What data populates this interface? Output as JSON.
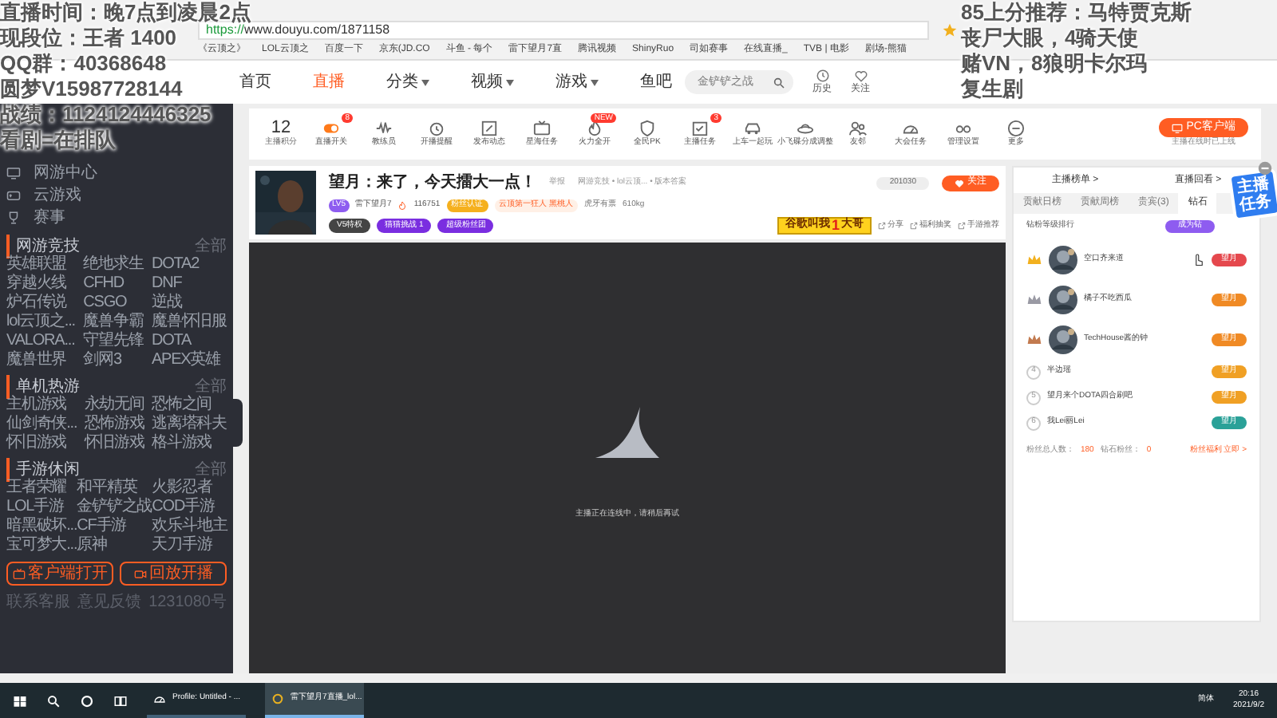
{
  "overlay": {
    "left_lines": [
      "直播时间：晚7点到凌晨2点",
      "现段位：王者 1400",
      "QQ群：40368648",
      "圆梦V15987728144",
      "战绩：1124124446325",
      "看剧=在排队"
    ],
    "right_lines": [
      "85上分推荐：马特贾克斯",
      "丧尸大眼，4骑天使",
      "赌VN，8狼明卡尔玛",
      "复生剧"
    ]
  },
  "browser": {
    "url_prefix": "https://",
    "url": "www.douyu.com/1871158",
    "bookmarks": [
      "《云顶之》",
      "LOL云顶之",
      "百度一下",
      "京东(JD.CO",
      "斗鱼 - 每个",
      "雷下望月7直",
      "腾讯视频",
      "ShinyRuo",
      "司如赛事",
      "在线直播_",
      "TVB | 电影",
      "剧场-熊猫"
    ]
  },
  "header": {
    "nav": [
      {
        "label": "首页",
        "selected": false,
        "caret": false
      },
      {
        "label": "直播",
        "selected": true,
        "caret": false
      },
      {
        "label": "分类",
        "selected": false,
        "caret": true
      },
      {
        "label": "视频",
        "selected": false,
        "caret": true
      },
      {
        "label": "游戏",
        "selected": false,
        "caret": true
      },
      {
        "label": "鱼吧",
        "selected": false,
        "caret": false
      }
    ],
    "search": {
      "placeholder": "金铲铲之战"
    },
    "actions": [
      "历史",
      "关注"
    ]
  },
  "toolbar": {
    "score": {
      "value": "12",
      "label": "主播积分"
    },
    "items": [
      {
        "label": "直播开关",
        "badge": "8"
      },
      {
        "label": "教练员"
      },
      {
        "label": "开播提醒"
      },
      {
        "label": "发布动态"
      },
      {
        "label": "星海任务"
      },
      {
        "label": "火力全开",
        "badge": "NEW"
      },
      {
        "label": "全民PK"
      },
      {
        "label": "主播任务",
        "badge": "3"
      },
      {
        "label": "上车一起玩"
      },
      {
        "label": "小飞碟分成调整"
      },
      {
        "label": "友邻"
      },
      {
        "label": "大会任务"
      },
      {
        "label": "管理设置"
      },
      {
        "label": "更多"
      }
    ],
    "pc_button": "PC客户端",
    "pc_note": "主播在线时已上线"
  },
  "sidebar": {
    "top": [
      "网游中心",
      "云游戏",
      "赛事"
    ],
    "sections": [
      {
        "title": "网游竞技",
        "more": "全部",
        "games": [
          "英雄联盟",
          "绝地求生",
          "DOTA2",
          "穿越火线",
          "CFHD",
          "DNF",
          "炉石传说",
          "CSGO",
          "逆战",
          "lol云顶之...",
          "魔兽争霸",
          "魔兽怀旧服",
          "VALORA...",
          "守望先锋",
          "DOTA",
          "魔兽世界",
          "剑网3",
          "APEX英雄"
        ]
      },
      {
        "title": "单机热游",
        "more": "全部",
        "games": [
          "主机游戏",
          "永劫无间",
          "恐怖之间",
          "仙剑奇侠...",
          "恐怖游戏",
          "逃离塔科夫",
          "怀旧游戏",
          "怀旧游戏",
          "格斗游戏"
        ]
      },
      {
        "title": "手游休闲",
        "more": "全部",
        "games": [
          "王者荣耀",
          "和平精英",
          "火影忍者",
          "LOL手游",
          "金铲铲之战",
          "COD手游",
          "暗黑破坏...",
          "CF手游",
          "欢乐斗地主",
          "宝可梦大...",
          "原神",
          "天刀手游"
        ]
      }
    ],
    "buttons": [
      "客户端打开",
      "回放开播"
    ],
    "footer": [
      "联系客服",
      "意见反馈",
      "1231080号"
    ]
  },
  "stream": {
    "title": "望月：来了，今天擂大一点！",
    "report": "举报",
    "breadcrumb": "网游竞技 • lol云顶... • 版本答案",
    "level": "LV5",
    "anchor": "雷下望月7",
    "heat": "116751",
    "fan_tag": "粉丝认证",
    "honor": "云顶第一狂人 黑桃人",
    "rank": "虎牙有票",
    "weight": "610kg",
    "room_id": "201030",
    "follow": "关注",
    "chips": [
      "V5特权",
      "猫猫挑战 1",
      "超级粉丝团"
    ],
    "promo": [
      "谷歌叫我",
      "1",
      "大哥"
    ],
    "actions": [
      "分享",
      "福利抽奖",
      "手游推荐"
    ]
  },
  "video": {
    "message": "主播正在连线中，请稍后再试"
  },
  "ranking": {
    "heads": [
      "主播榜单 >",
      "直播回看 >"
    ],
    "tabs": [
      {
        "label": "贡献日榜",
        "selected": false
      },
      {
        "label": "贡献周榜",
        "selected": false
      },
      {
        "label": "贵宾(3)",
        "selected": false
      },
      {
        "label": "钻石",
        "selected": true
      }
    ],
    "caption": "钻粉等级排行",
    "join": "成为钻",
    "sticker": "主播任务",
    "rows": [
      {
        "kind": "crown",
        "color": "#f2b01e",
        "name": "空口齐来道",
        "badge": {
          "label": "望月",
          "color": "#e5484d"
        }
      },
      {
        "kind": "crown",
        "color": "#9a9aa4",
        "name": "橘子不吃西瓜",
        "badge": {
          "label": "望月",
          "color": "#f08a24"
        }
      },
      {
        "kind": "crown",
        "color": "#c27a4f",
        "name": "TechHouse酱的钟",
        "badge": {
          "label": "望月",
          "color": "#f08a24"
        }
      },
      {
        "kind": "number",
        "rank": "4",
        "name": "半边瑶",
        "badge": {
          "label": "望月",
          "color": "#f0a024"
        }
      },
      {
        "kind": "number",
        "rank": "5",
        "name": "望月来个DOTA四合刷吧",
        "badge": {
          "label": "望月",
          "color": "#f0a024"
        }
      },
      {
        "kind": "number",
        "rank": "6",
        "name": "我Lei丽Lei",
        "badge": {
          "label": "望月",
          "color": "#2aa198"
        }
      }
    ],
    "footer": {
      "total_label": "粉丝总人数：",
      "total": "180",
      "diamond_label": "钻石粉丝：",
      "diamond": "0",
      "link": "粉丝福利 立即 >"
    }
  },
  "taskbar": {
    "apps": [
      {
        "label": "Profile: Untitled - ...",
        "selected": false
      },
      {
        "label": "雷下望月7直播_lol...",
        "selected": true
      }
    ],
    "ime": "简体",
    "time": "20:16",
    "date": "2021/9/2"
  }
}
